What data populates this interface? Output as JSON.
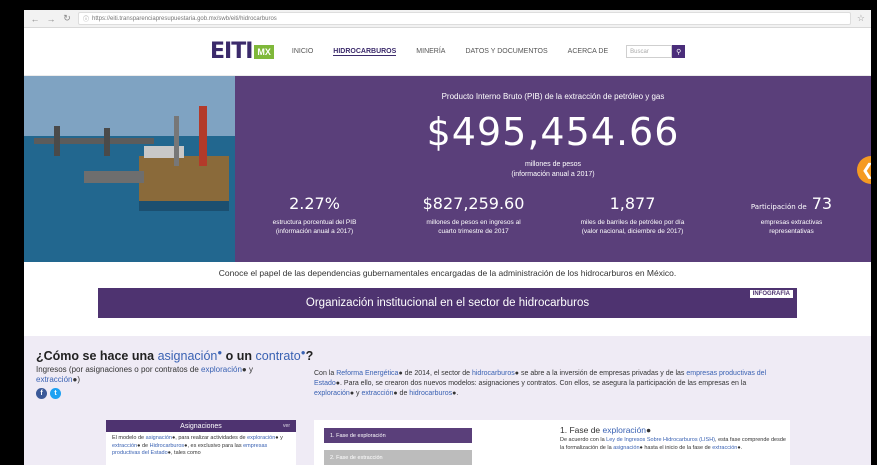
{
  "browser": {
    "url": "https://eiti.transparenciapresupuestaria.gob.mx/swb/eiti/hidrocarburos"
  },
  "header": {
    "logo_text": "EITI",
    "logo_badge": "MX",
    "menu": [
      "INICIO",
      "HIDROCARBUROS",
      "MINERÍA",
      "DATOS Y DOCUMENTOS",
      "ACERCA DE"
    ],
    "active_menu": "HIDROCARBUROS",
    "search_placeholder": "Buscar"
  },
  "hero": {
    "pib_title": "Producto Interno Bruto (PIB) de la extracción de petróleo y gas",
    "pib_value": "$495,454.66",
    "pib_unit": "millones de pesos",
    "pib_note": "(información anual a 2017)",
    "stats": [
      {
        "value": "2.27%",
        "line1": "estructura porcentual del PIB",
        "line2": "(información anual a 2017)"
      },
      {
        "value": "$827,259.60",
        "line1": "millones de pesos en ingresos al",
        "line2": "cuarto trimestre de 2017"
      },
      {
        "value": "1,877",
        "line1": "miles de barriles de petróleo por día",
        "line2": "(valor nacional, diciembre de 2017)"
      },
      {
        "prefix": "Participación de",
        "value": "73",
        "line1": "empresas extractivas",
        "line2": "representativas"
      }
    ]
  },
  "conoce": {
    "text": "Conoce el papel de las dependencias gubernamentales encargadas de la administración de los hidrocarburos en México.",
    "banner": "Organización institucional en el sector de hidrocarburos",
    "badge": "INFOGRAFÍA"
  },
  "how": {
    "title_pre": "¿Cómo se hace una",
    "title_link1": "asignación",
    "title_mid": "o un",
    "title_link2": "contrato",
    "title_post": "?",
    "sub_pre": "Ingresos (por asignaciones o por contratos de",
    "sub_link1": "exploración",
    "sub_mid": "y",
    "sub_link2": "extracción",
    "sub_post": ")"
  },
  "intro": {
    "p1": "Con la",
    "l1": "Reforma Energética",
    "p2": "de 2014, el sector de",
    "l2": "hidrocarburos",
    "p3": "se abre a la inversión de empresas privadas y de las",
    "l3": "empresas productivas del Estado",
    "p4": ". Para ello, se crearon dos nuevos modelos: asignaciones y contratos. Con ellos, se asegura la participación de las empresas en la",
    "l4": "exploración",
    "p5": "y",
    "l5": "extracción",
    "p6": "de",
    "l6": "hidrocarburos",
    "p7": "."
  },
  "asignaciones": {
    "title": "Asignaciones",
    "mini": "ver",
    "b1": "El modelo de",
    "bl1": "asignación",
    "b2": ", para realizar actividades de",
    "bl2": "exploración",
    "b3": "y",
    "bl3": "extracción",
    "b4": "de",
    "bl4": "Hidrocarburos",
    "b5": ", es exclusivo para las",
    "bl5": "empresas productivas del Estado",
    "b6": ", tales como"
  },
  "phases": {
    "btn1": "1. Fase de exploración",
    "btn2": "2. Fase de extracción",
    "detail_num": "1. Fase de",
    "detail_link": "exploración",
    "d1": "De acuerdo con la",
    "dl1": "Ley de Ingresos Sobre Hidrocarburos (LISH)",
    "d2": ", esta fase comprende desde la formalización de la",
    "dl2": "asignación",
    "d3": "hasta el inicio de la fase de",
    "dl3": "extracción",
    "d4": "."
  }
}
